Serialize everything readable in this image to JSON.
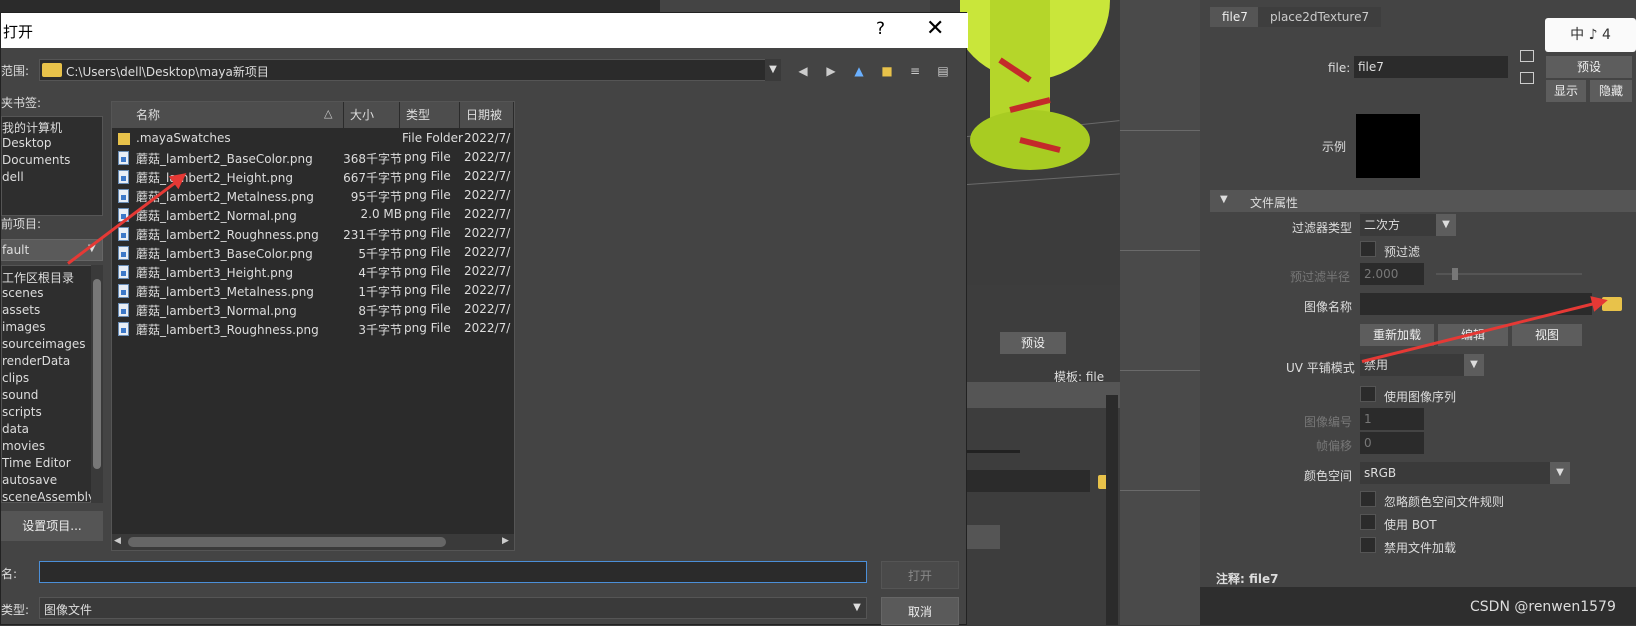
{
  "dialog": {
    "title": "打开",
    "help": "?",
    "close": "✕",
    "look_in_label": "范围:",
    "path": "C:\\Users\\dell\\Desktop\\maya新项目",
    "bookmarks_label": "夹书签:",
    "bookmarks": [
      "我的计算机",
      "Desktop",
      "Documents",
      "dell"
    ],
    "project_label": "前项目:",
    "project_value": "fault",
    "project_dirs": [
      "工作区根目录",
      "scenes",
      "assets",
      "images",
      "sourceimages",
      "renderData",
      "clips",
      "sound",
      "scripts",
      "data",
      "movies",
      "Time Editor",
      "autosave",
      "sceneAssembly"
    ],
    "set_project": "设置项目...",
    "columns": [
      "名称",
      "大小",
      "类型",
      "日期被"
    ],
    "files": [
      {
        "name": ".mayaSwatches",
        "size": "",
        "type": "File Folder",
        "date": "2022/7/",
        "folder": true
      },
      {
        "name": "蘑菇_lambert2_BaseColor.png",
        "size": "368千字节",
        "type": "png File",
        "date": "2022/7/"
      },
      {
        "name": "蘑菇_lambert2_Height.png",
        "size": "667千字节",
        "type": "png File",
        "date": "2022/7/"
      },
      {
        "name": "蘑菇_lambert2_Metalness.png",
        "size": "95千字节",
        "type": "png File",
        "date": "2022/7/"
      },
      {
        "name": "蘑菇_lambert2_Normal.png",
        "size": "2.0 MB",
        "type": "png File",
        "date": "2022/7/"
      },
      {
        "name": "蘑菇_lambert2_Roughness.png",
        "size": "231千字节",
        "type": "png File",
        "date": "2022/7/"
      },
      {
        "name": "蘑菇_lambert3_BaseColor.png",
        "size": "5千字节",
        "type": "png File",
        "date": "2022/7/"
      },
      {
        "name": "蘑菇_lambert3_Height.png",
        "size": "4千字节",
        "type": "png File",
        "date": "2022/7/"
      },
      {
        "name": "蘑菇_lambert3_Metalness.png",
        "size": "1千字节",
        "type": "png File",
        "date": "2022/7/"
      },
      {
        "name": "蘑菇_lambert3_Normal.png",
        "size": "8千字节",
        "type": "png File",
        "date": "2022/7/"
      },
      {
        "name": "蘑菇_lambert3_Roughness.png",
        "size": "3千字节",
        "type": "png File",
        "date": "2022/7/"
      }
    ],
    "filename_label": "名:",
    "filename_value": "",
    "filetype_label": "类型:",
    "filetype_value": "图像文件",
    "open_button": "打开",
    "cancel_button": "取消"
  },
  "middle": {
    "preset_button": "预设",
    "template_label": "模板: file"
  },
  "attr": {
    "tabs": [
      "file7",
      "place2dTexture7"
    ],
    "file_label": "file:",
    "file_value": "file7",
    "preset_button": "预设",
    "show_button": "显示",
    "hide_button": "隐藏",
    "sample_label": "示例",
    "section_title": "文件属性",
    "filter_type_label": "过滤器类型",
    "filter_type_value": "二次方",
    "prefilter_label": "预过滤",
    "prefilter_radius_label": "预过滤半径",
    "prefilter_radius_value": "2.000",
    "image_name_label": "图像名称",
    "image_name_value": "",
    "reload_button": "重新加载",
    "edit_button": "编辑",
    "view_button": "视图",
    "uv_tiling_label": "UV 平铺模式",
    "uv_tiling_value": "禁用",
    "use_image_seq_label": "使用图像序列",
    "frame_label": "图像编号",
    "frame_value": "1",
    "frame_offset_label": "帧偏移",
    "frame_offset_value": "0",
    "color_space_label": "颜色空间",
    "color_space_value": "sRGB",
    "ignore_rules_label": "忽略颜色空间文件规则",
    "use_bot_label": "使用 BOT",
    "disable_load_label": "禁用文件加载",
    "notes_label": "注释:  file7",
    "logo_text": "中 ♪ 4",
    "watermark": "CSDN @renwen1579"
  },
  "colors": {
    "accent": "#e53935",
    "folder": "#e8c24a",
    "ball": "#b5d62a"
  }
}
